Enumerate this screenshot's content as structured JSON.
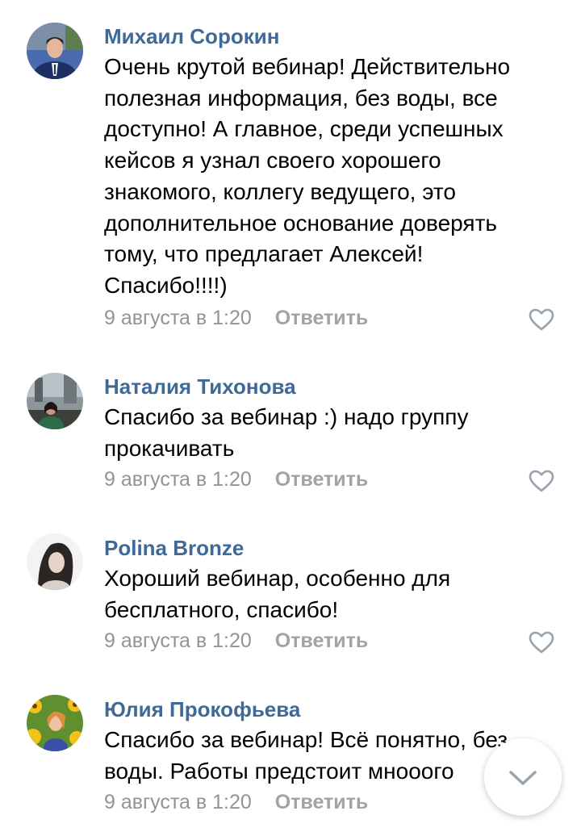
{
  "comments": [
    {
      "author": "Михаил Сорокин",
      "lines": [
        "Очень крутой вебинар! Действительно",
        "полезная информация, без воды, все",
        "доступно! А главное, среди успешных",
        "кейсов я узнал своего хорошего",
        "знакомого, коллегу ведущего, это",
        "дополнительное основание доверять",
        "тому, что предлагает Алексей!",
        "Спасибо!!!!)"
      ],
      "date": "9 августа в 1:20",
      "reply": "Ответить"
    },
    {
      "author": "Наталия Тихонова",
      "lines": [
        "Спасибо за вебинар :) надо группу",
        "прокачивать"
      ],
      "date": "9 августа в 1:20",
      "reply": "Ответить"
    },
    {
      "author": "Polina Bronze",
      "lines": [
        "Хороший вебинар, особенно для",
        "бесплатного, спасибо!"
      ],
      "date": "9 августа в 1:20",
      "reply": "Ответить"
    },
    {
      "author": "Юлия Прокофьева",
      "lines": [
        "Спасибо за вебинар! Всё понятно, без",
        "воды. Работы предстоит мнооого"
      ],
      "date": "9 августа в 1:20",
      "reply": "Ответить"
    }
  ],
  "icons": {
    "like": "heart-outline-icon",
    "scroll_down": "chevron-down-icon"
  },
  "colors": {
    "author": "#3f6a97",
    "meta": "#909499",
    "icon": "#99a2ad"
  }
}
